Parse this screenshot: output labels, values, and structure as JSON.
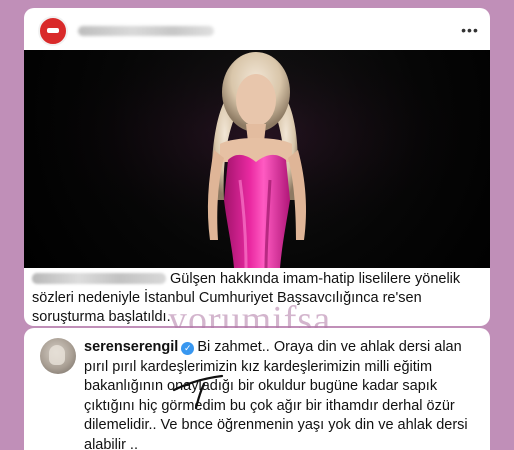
{
  "post": {
    "caption_text": "Gülşen hakkında imam-hatip liselilere yönelik sözleri nedeniyle İstanbul Cumhuriyet Başsavcılığınca re'sen soruşturma başlatıldı."
  },
  "comment": {
    "username": "serenserengil",
    "text": "Bi zahmet.. Oraya din ve ahlak dersi alan pırıl pırıl kardeşlerimizin kız kardeşlerimizin milli eğitim bakanlığının onayladığı bir okuldur bugüne kadar sapık çıktığını hiç görmedim  bu çok ağır bir ithamdır derhal özür dilemelidir.. Ve bnce öğrenmenin yaşı yok din ve ahlak dersi alabilir .."
  },
  "watermark": {
    "text": "yorumifsa"
  },
  "colors": {
    "background": "#c08fb8",
    "dress": "#e0249a",
    "verified": "#3897f0"
  },
  "icons": {
    "more": "more-dots-icon",
    "verified": "verified-badge-icon"
  }
}
